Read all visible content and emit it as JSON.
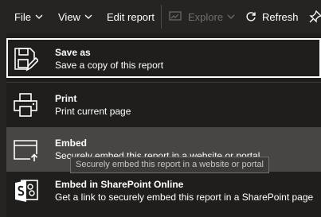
{
  "toolbar": {
    "file_label": "File",
    "view_label": "View",
    "edit_report_label": "Edit report",
    "explore_label": "Explore",
    "refresh_label": "Refresh"
  },
  "menu": {
    "items": [
      {
        "title": "Save as",
        "description": "Save a copy of this report",
        "icon": "save-as-icon"
      },
      {
        "title": "Print",
        "description": "Print current page",
        "icon": "printer-icon"
      },
      {
        "title": "Embed",
        "description": "Securely embed this report in a website or portal",
        "icon": "embed-icon"
      },
      {
        "title": "Embed in SharePoint Online",
        "description": "Get a link to securely embed this report in a SharePoint page",
        "icon": "sharepoint-icon"
      }
    ]
  },
  "tooltip": {
    "text": "Securely embed this report in a website or portal"
  },
  "colors": {
    "background": "#252423",
    "menu_background": "#1f1e1d",
    "hover_background": "#484644",
    "text": "#ffffff",
    "disabled_text": "#6f6e6d"
  }
}
